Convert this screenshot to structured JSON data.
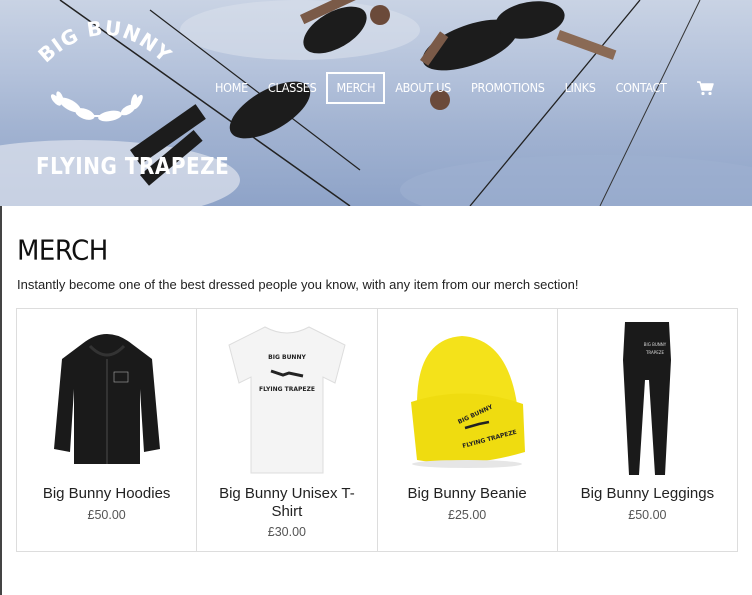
{
  "brand": {
    "name_top": "BIG BUNNY",
    "name_bottom": "FLYING TRAPEZE"
  },
  "nav": {
    "items": [
      {
        "label": "HOME"
      },
      {
        "label": "CLASSES"
      },
      {
        "label": "MERCH",
        "active": true
      },
      {
        "label": "ABOUT US"
      },
      {
        "label": "PROMOTIONS"
      },
      {
        "label": "LINKS"
      },
      {
        "label": "CONTACT"
      }
    ],
    "cart_icon": "cart-icon"
  },
  "page": {
    "title": "MERCH",
    "intro": "Instantly become one of the best dressed people you know, with any item from our merch section!"
  },
  "products": [
    {
      "name": "Big Bunny Hoodies",
      "price": "£50.00",
      "image_icon": "hoodie-icon"
    },
    {
      "name": "Big Bunny Unisex T-Shirt",
      "price": "£30.00",
      "image_icon": "tshirt-icon"
    },
    {
      "name": "Big Bunny Beanie",
      "price": "£25.00",
      "image_icon": "beanie-icon"
    },
    {
      "name": "Big Bunny Leggings",
      "price": "£50.00",
      "image_icon": "leggings-icon"
    }
  ],
  "colors": {
    "beanie": "#f4e21a",
    "garment_dark": "#1a1a1a",
    "tshirt": "#f4f4f4"
  }
}
